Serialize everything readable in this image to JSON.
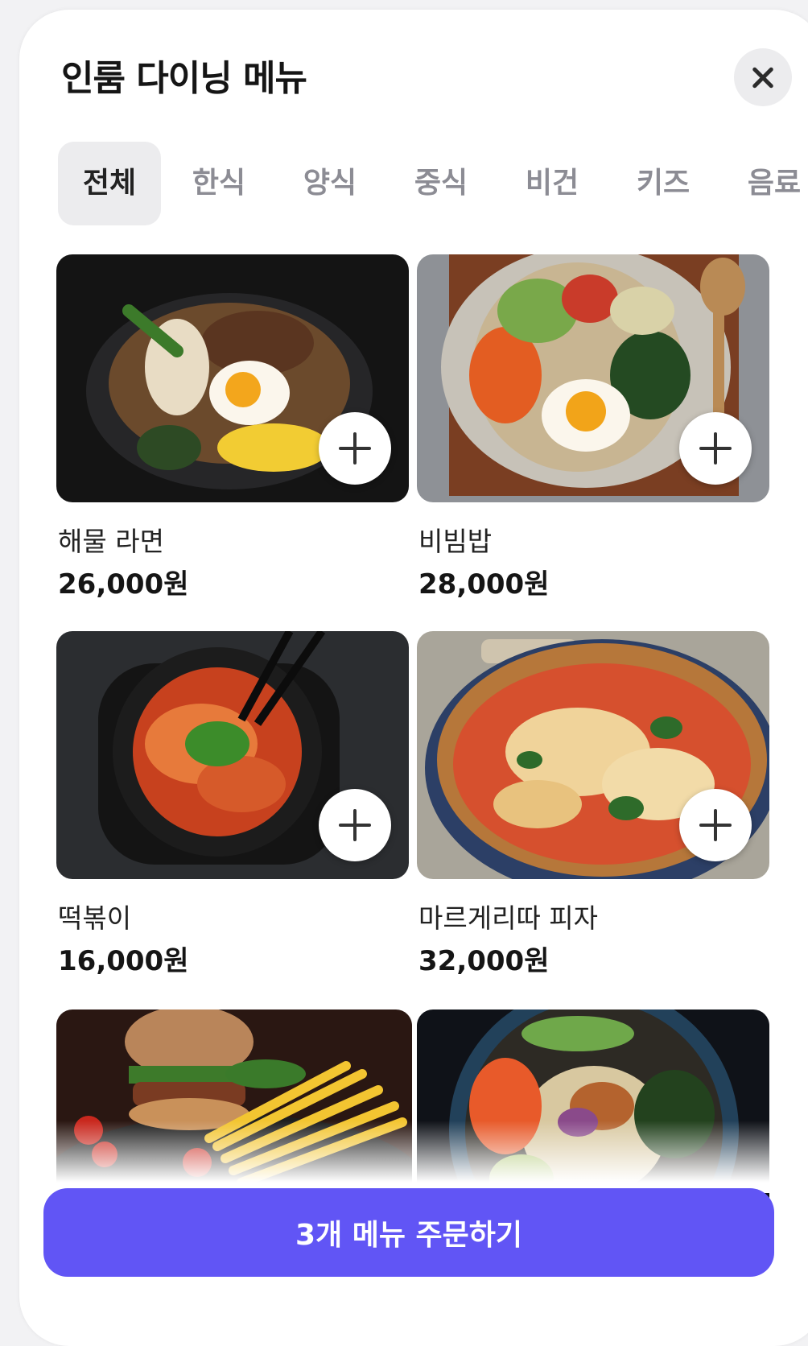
{
  "header": {
    "title": "인룸 다이닝 메뉴",
    "close_icon": "close-icon"
  },
  "tabs": [
    {
      "label": "전체",
      "active": true
    },
    {
      "label": "한식",
      "active": false
    },
    {
      "label": "양식",
      "active": false
    },
    {
      "label": "중식",
      "active": false
    },
    {
      "label": "비건",
      "active": false
    },
    {
      "label": "키즈",
      "active": false
    },
    {
      "label": "음료",
      "active": false
    }
  ],
  "menu": [
    {
      "name": "해물 라면",
      "price": "26,000원"
    },
    {
      "name": "비빔밥",
      "price": "28,000원"
    },
    {
      "name": "떡볶이",
      "price": "16,000원"
    },
    {
      "name": "마르게리따 피자",
      "price": "32,000원"
    },
    {
      "name": "",
      "price": ""
    },
    {
      "name": "",
      "price": ""
    }
  ],
  "order_button": {
    "label": "3개 메뉴 주문하기"
  },
  "colors": {
    "accent": "#6155f5",
    "active_tab_bg": "#ececee",
    "inactive_tab_text": "#8c8c94"
  }
}
